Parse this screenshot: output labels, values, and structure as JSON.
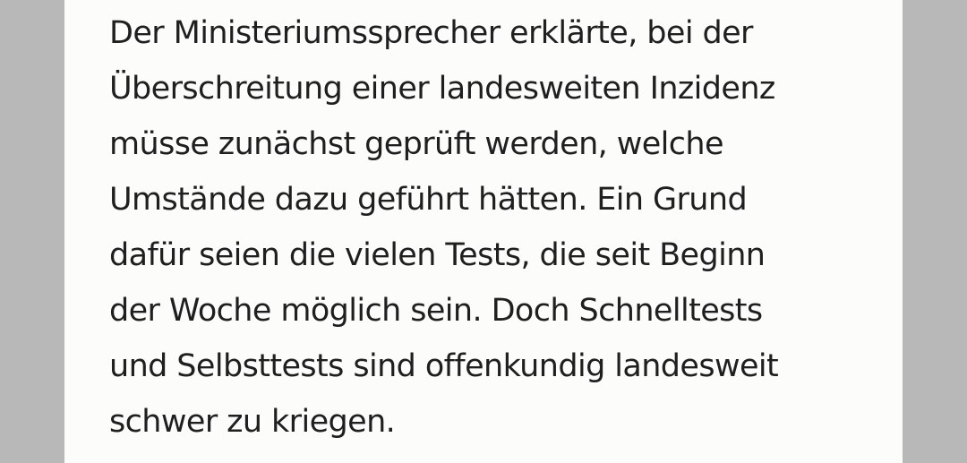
{
  "article": {
    "lines": [
      "Der Ministeriumssprecher erklärte, bei der",
      "Überschreitung einer landesweiten Inzidenz",
      "müsse zunächst geprüft werden, welche",
      "Umstände dazu geführt hätten. Ein Grund",
      "dafür seien die vielen Tests, die seit Beginn",
      "der Woche möglich sein. Doch Schnelltests",
      "und Selbsttests sind offenkundig landesweit",
      "schwer zu kriegen."
    ]
  }
}
